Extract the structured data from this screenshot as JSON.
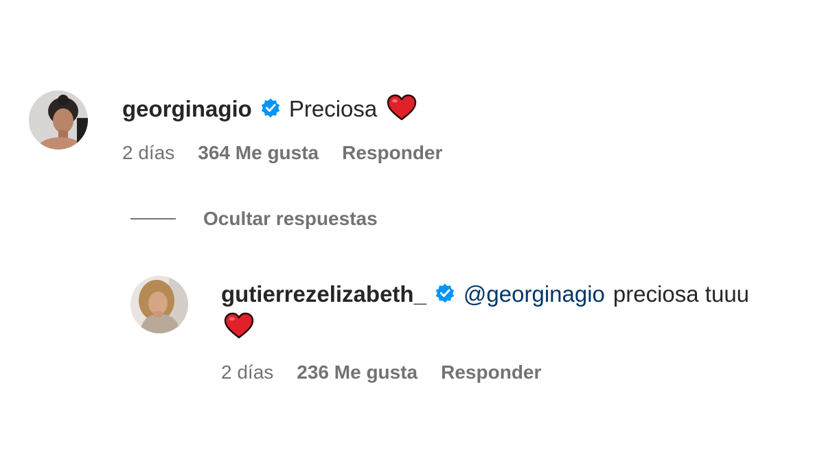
{
  "comment": {
    "username": "georginagio",
    "text": "Preciosa",
    "time": "2 días",
    "likes": "364 Me gusta",
    "reply_label": "Responder"
  },
  "replies_toggle": {
    "label": "Ocultar respuestas"
  },
  "reply": {
    "username": "gutierrezelizabeth_",
    "mention": "@georginagio",
    "text": "preciosa tuuu",
    "time": "2 días",
    "likes": "236 Me gusta",
    "reply_label": "Responder"
  },
  "colors": {
    "verified_badge": "#0095f6",
    "heart": "#e0212c",
    "mention": "#00376b",
    "secondary_text": "#737373",
    "primary_text": "#262626"
  },
  "icons": {
    "verified": "verified-badge-icon",
    "heart": "red-heart-emoji-icon"
  }
}
